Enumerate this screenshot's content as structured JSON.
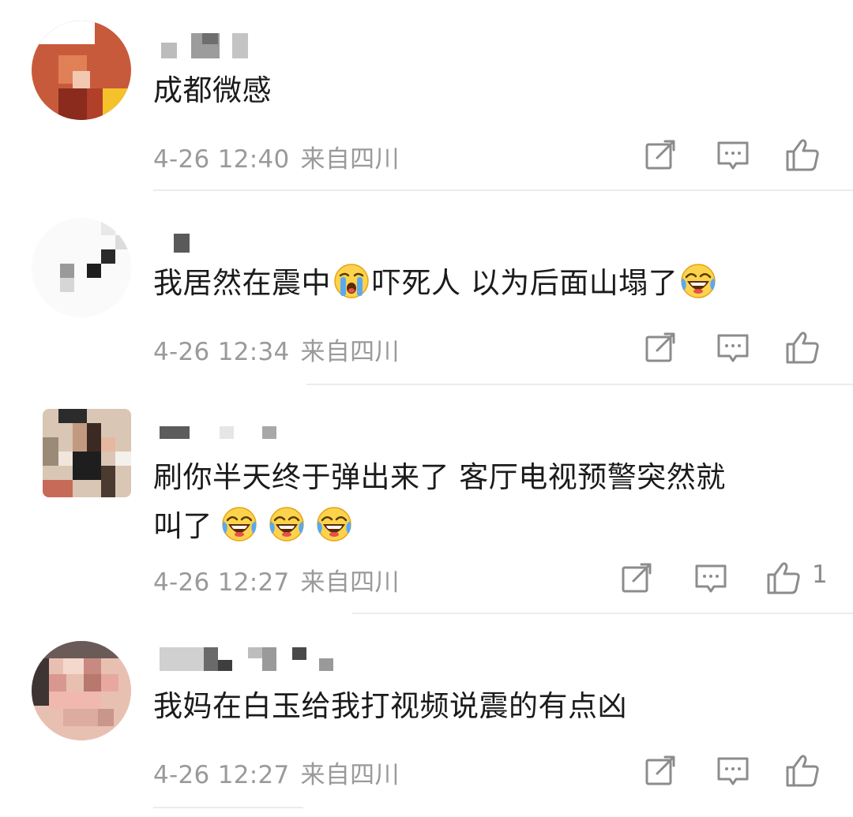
{
  "comments": [
    {
      "text": "成都微感",
      "time": "4-26 12:40",
      "location": "来自四川",
      "likes": ""
    },
    {
      "text_parts": [
        "我居然在震中",
        "吓死人 以为后面山塌了"
      ],
      "time": "4-26 12:34",
      "location": "来自四川",
      "likes": ""
    },
    {
      "line1": "刷你半天终于弹出来了 客厅电视预警突然就",
      "line2": "叫了",
      "time": "4-26 12:27",
      "location": "来自四川",
      "likes": "1"
    },
    {
      "text": "我妈在白玉给我打视频说震的有点凶",
      "time": "4-26 12:27",
      "location": "来自四川",
      "likes": ""
    }
  ],
  "icons": {
    "repost": "repost-icon",
    "comment": "comment-icon",
    "like": "thumbs-up-icon",
    "crying": "crying-emoji",
    "laughing": "laugh-cry-emoji"
  },
  "colors": {
    "text": "#1b1b1b",
    "meta": "#9a9a9a",
    "icon": "#8c8c8c",
    "divider": "#ececec"
  }
}
